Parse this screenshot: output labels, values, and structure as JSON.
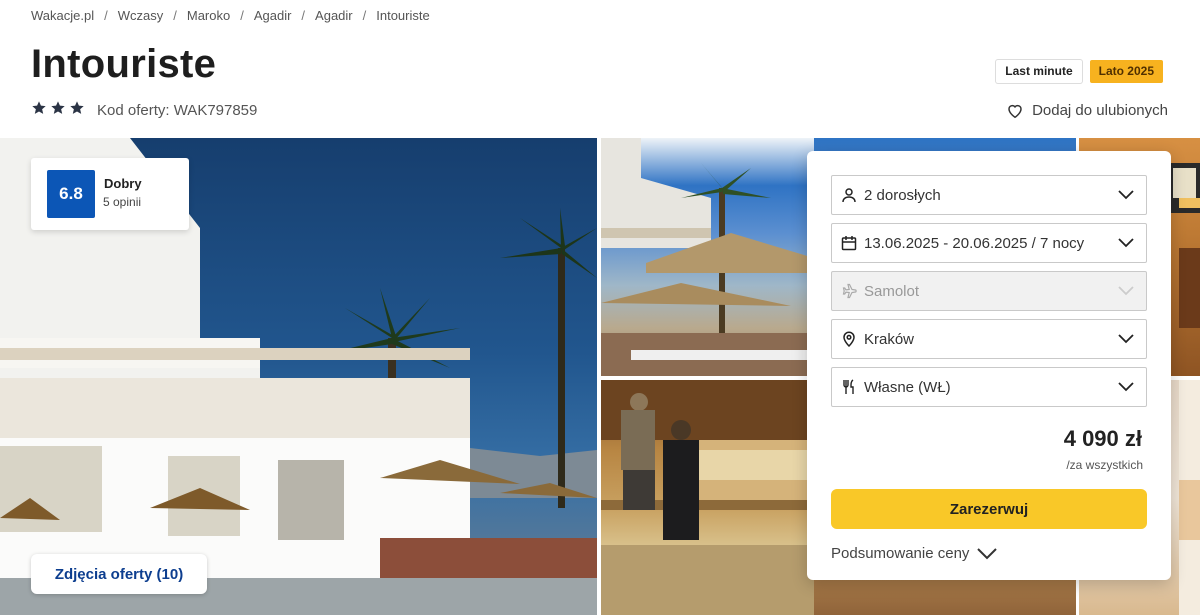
{
  "breadcrumb": [
    "Wakacje.pl",
    "Wczasy",
    "Maroko",
    "Agadir",
    "Agadir",
    "Intouriste"
  ],
  "hotel": {
    "name": "Intouriste",
    "stars": 3,
    "offer_code": "Kod oferty: WAK797859"
  },
  "tags": {
    "last_minute": "Last minute",
    "season": "Lato 2025"
  },
  "favorites_label": "Dodaj do ulubionych",
  "rating": {
    "score": "6.8",
    "label": "Dobry",
    "count": "5 opinii"
  },
  "photos_button": "Zdjęcia oferty (10)",
  "booking": {
    "guests": "2 dorosłych",
    "dates": "13.06.2025 - 20.06.2025 / 7 nocy",
    "transport": "Samolot",
    "departure": "Kraków",
    "board": "Własne (WŁ)",
    "price": "4 090 zł",
    "price_note": "/za wszystkich",
    "reserve": "Zarezerwuj",
    "summary": "Podsumowanie ceny"
  },
  "colors": {
    "rating_badge": "#0c56b6",
    "reserve_button": "#f9c828",
    "season_tag": "#f7b21f",
    "photos_button_text": "#0d3e8f"
  }
}
